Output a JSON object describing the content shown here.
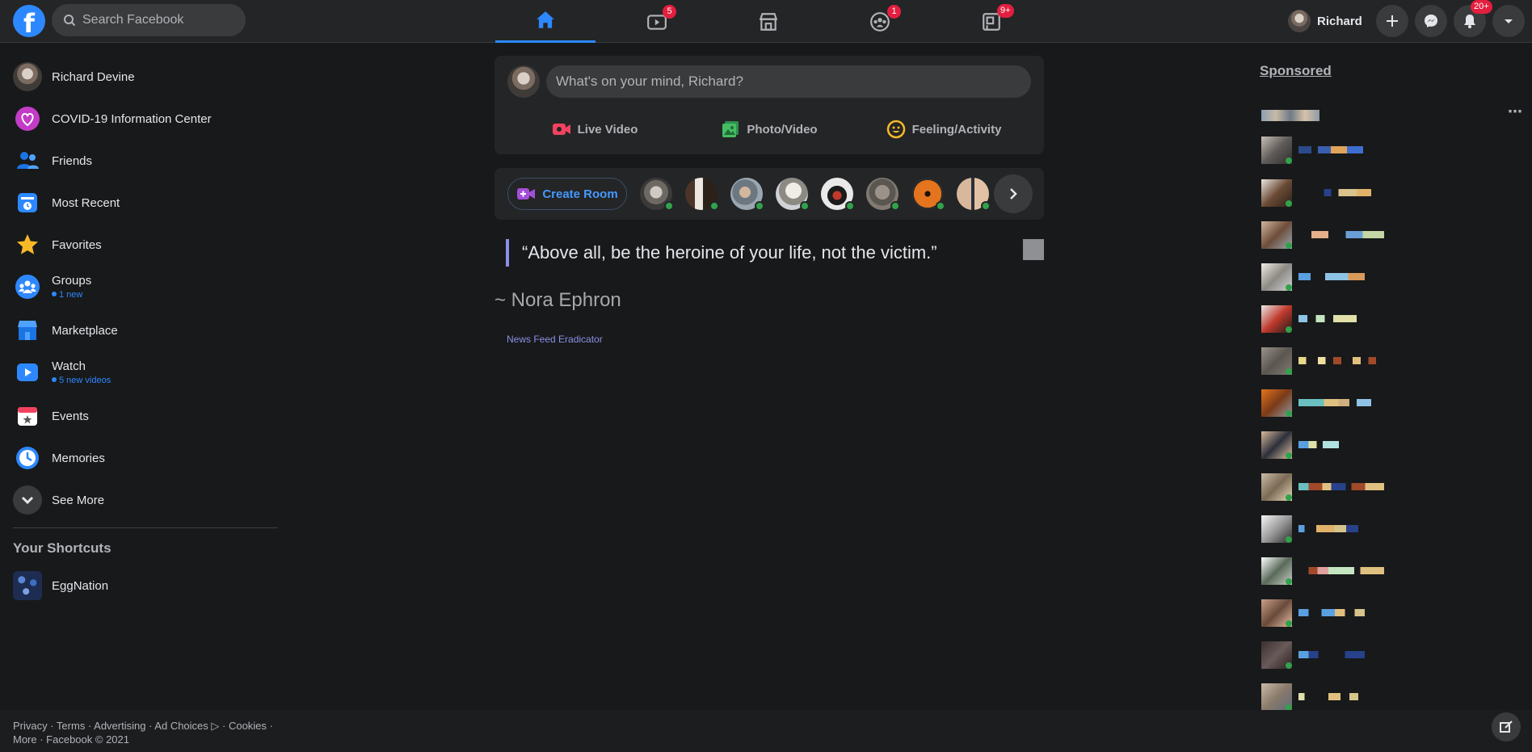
{
  "header": {
    "search_placeholder": "Search Facebook",
    "profile_name": "Richard",
    "badges": {
      "watch": "5",
      "groups": "1",
      "gaming": "9+",
      "notifications": "20+"
    }
  },
  "sidebar": {
    "items": [
      {
        "label": "Richard Devine"
      },
      {
        "label": "COVID-19 Information Center"
      },
      {
        "label": "Friends"
      },
      {
        "label": "Most Recent"
      },
      {
        "label": "Favorites"
      },
      {
        "label": "Groups",
        "sub": "1 new"
      },
      {
        "label": "Marketplace"
      },
      {
        "label": "Watch",
        "sub": "5 new videos"
      },
      {
        "label": "Events"
      },
      {
        "label": "Memories"
      },
      {
        "label": "See More"
      }
    ],
    "shortcuts_title": "Your Shortcuts",
    "shortcuts": [
      {
        "label": "EggNation"
      }
    ]
  },
  "composer": {
    "placeholder": "What's on your mind, Richard?",
    "actions": [
      "Live Video",
      "Photo/Video",
      "Feeling/Activity"
    ]
  },
  "rooms": {
    "create_label": "Create Room"
  },
  "feed": {
    "quote": "“Above all, be the heroine of your life, not the victim.”",
    "author": "~ Nora Ephron",
    "extension_link": "News Feed Eradicator"
  },
  "right": {
    "sponsored_title": "Sponsored"
  },
  "footer": {
    "line1": "Privacy · Terms · Advertising · Ad Choices ▷ · Cookies ·",
    "line2": "More · Facebook © 2021"
  },
  "colors": {
    "accent": "#2d88ff",
    "background": "#18191a",
    "surface": "#242526",
    "notification": "#e41e3f",
    "online": "#31a24c"
  }
}
